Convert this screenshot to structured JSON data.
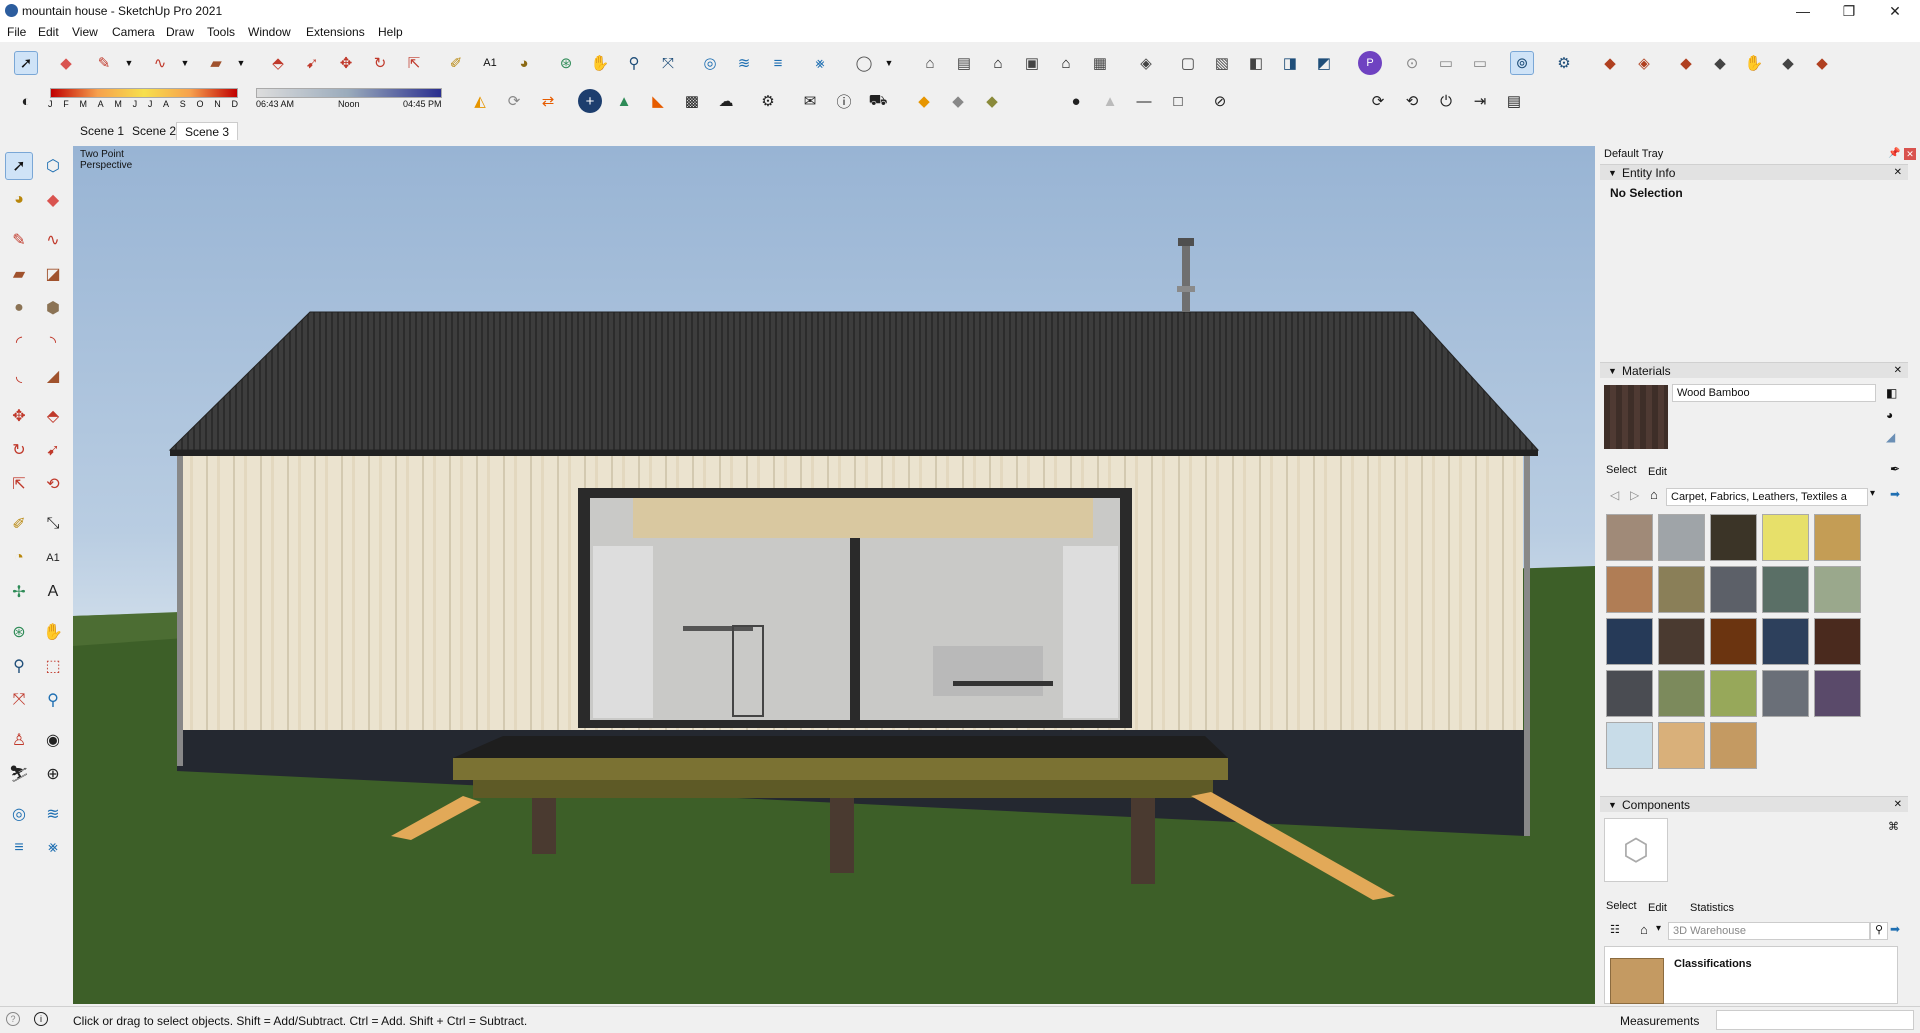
{
  "window": {
    "title": "mountain house - SketchUp Pro 2021",
    "minimize": "—",
    "maximize": "❐",
    "close": "✕"
  },
  "menu": [
    "File",
    "Edit",
    "View",
    "Camera",
    "Draw",
    "Tools",
    "Window",
    "Extensions",
    "Help"
  ],
  "shadow_bar": {
    "months": [
      "J",
      "F",
      "M",
      "A",
      "M",
      "J",
      "J",
      "A",
      "S",
      "O",
      "N",
      "D"
    ],
    "time_start": "06:43 AM",
    "time_mid": "Noon",
    "time_end": "04:45 PM"
  },
  "scenes": [
    "Scene 1",
    "Scene 2",
    "Scene 3"
  ],
  "active_scene": "Scene 3",
  "viewport": {
    "camera_label_line1": "Two Point",
    "camera_label_line2": "Perspective"
  },
  "tray": {
    "title": "Default Tray",
    "entity_info": {
      "header": "Entity Info",
      "selection": "No Selection"
    },
    "materials": {
      "header": "Materials",
      "current_material": "Wood Bamboo",
      "tab_select": "Select",
      "tab_edit": "Edit",
      "library": "Carpet, Fabrics, Leathers, Textiles a",
      "swatch_colors": [
        "#a08a78",
        "#9fa4a8",
        "#3b3427",
        "#e7e06a",
        "#c49d55",
        "#b07d55",
        "#8a7f58",
        "#5c6068",
        "#5a6f66",
        "#9aa88c",
        "#263a58",
        "#4a3a30",
        "#6b3410",
        "#2d405c",
        "#4a2a1e",
        "#4a4c52",
        "#7c8a5c",
        "#97a85a",
        "#6a6f78",
        "#5a4a6a",
        "#c8dce8",
        "#d9b07a",
        "#c49a62"
      ]
    },
    "components": {
      "header": "Components",
      "tab_select": "Select",
      "tab_edit": "Edit",
      "tab_statistics": "Statistics",
      "search_placeholder": "3D Warehouse",
      "item_title": "Classifications"
    }
  },
  "status": {
    "message": "Click or drag to select objects. Shift = Add/Subtract. Ctrl = Add. Shift + Ctrl = Subtract.",
    "measurements_label": "Measurements"
  },
  "colors": {
    "roof": "#3a3a3a",
    "cladding": "#e9e1cd",
    "grass": "#3c5e27",
    "deck_edge": "#6e6a2c"
  }
}
